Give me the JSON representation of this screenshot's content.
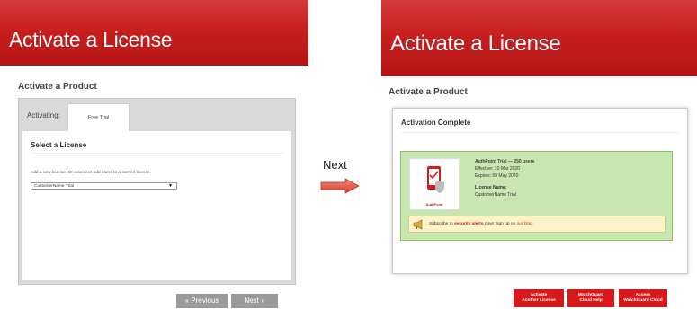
{
  "left": {
    "banner_title": "Activate a License",
    "section_heading": "Activate a Product",
    "activating_label": "Activating:",
    "product_tab": "Free Trial",
    "select_license_title": "Select a License",
    "instruction": "Add a new license. Or extend or add users to a current license.",
    "select_value": "CustomerName Trial",
    "previous_label": "« Previous",
    "next_label": "Next »"
  },
  "arrow_label": "Next",
  "right": {
    "banner_title": "Activate a License",
    "section_heading": "Activate a Product",
    "complete_title": "Activation Complete",
    "product_logo_caption": "AuthPoint",
    "product_line": "AuthPoint Trial — 250 users",
    "effective": "Effective: 10 Mar 2020",
    "expires": "Expires: 09 May 2020",
    "license_name_label": "License Name:",
    "license_name": "CustomerName Trial",
    "subscribe_prefix": "Subscribe to ",
    "subscribe_alerts": "security alerts",
    "subscribe_middle": " now! Sign up on ",
    "subscribe_blog": "our blog",
    "subscribe_end": ".",
    "buttons": {
      "activate_another_1": "Activate",
      "activate_another_2": "Another License",
      "cloud_help_1": "WatchGuard",
      "cloud_help_2": "Cloud Help",
      "access_cloud_1": "Access",
      "access_cloud_2": "WatchGuard Cloud"
    }
  },
  "colors": {
    "brand_red": "#c81f1f",
    "card_green": "#c8e6b0",
    "notice_yellow": "#fbf3c9",
    "nav_grey": "#9a9a9a"
  }
}
